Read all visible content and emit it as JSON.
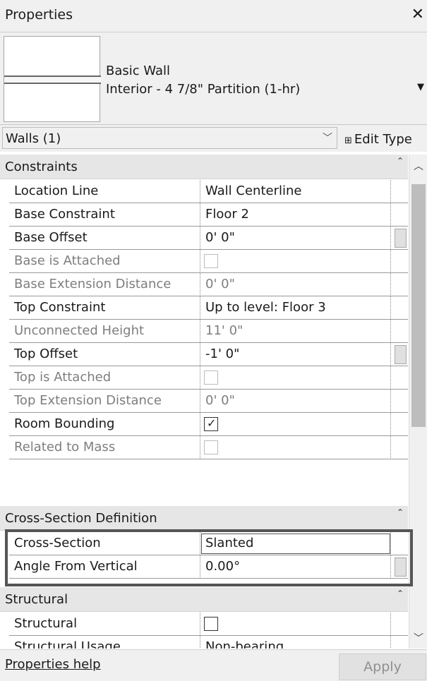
{
  "window": {
    "title": "Properties"
  },
  "type": {
    "family": "Basic Wall",
    "name": "Interior - 4 7/8\" Partition (1-hr)"
  },
  "selector": {
    "label": "Walls (1)",
    "edit_type": "Edit Type"
  },
  "groups": {
    "constraints": "Constraints",
    "cross_section": "Cross-Section Definition",
    "structural": "Structural"
  },
  "rows": {
    "location_line": {
      "name": "Location Line",
      "value": "Wall Centerline"
    },
    "base_constraint": {
      "name": "Base Constraint",
      "value": "Floor 2"
    },
    "base_offset": {
      "name": "Base Offset",
      "value": "0'  0\""
    },
    "base_attached": {
      "name": "Base is Attached"
    },
    "base_ext": {
      "name": "Base Extension Distance",
      "value": "0'  0\""
    },
    "top_constraint": {
      "name": "Top Constraint",
      "value": "Up to level: Floor 3"
    },
    "unconnected": {
      "name": "Unconnected Height",
      "value": "11'  0\""
    },
    "top_offset": {
      "name": "Top Offset",
      "value": "-1'  0\""
    },
    "top_attached": {
      "name": "Top is Attached"
    },
    "top_ext": {
      "name": "Top Extension Distance",
      "value": "0'  0\""
    },
    "room_bounding": {
      "name": "Room Bounding"
    },
    "related_mass": {
      "name": "Related to Mass"
    },
    "cross_section": {
      "name": "Cross-Section",
      "value": "Slanted"
    },
    "angle": {
      "name": "Angle From Vertical",
      "value": "0.00°"
    },
    "structural": {
      "name": "Structural"
    },
    "structural_usage": {
      "name": "Structural Usage",
      "value": "Non-bearing"
    }
  },
  "footer": {
    "help": "Properties help",
    "apply": "Apply"
  },
  "icons": {
    "close": "close-icon",
    "dropdown": "chevron-down-icon",
    "edit_type": "edit-type-icon",
    "collapse": "collapse-icon",
    "scroll_up": "scroll-up-icon",
    "scroll_down": "scroll-down-icon",
    "check": "check-icon"
  }
}
